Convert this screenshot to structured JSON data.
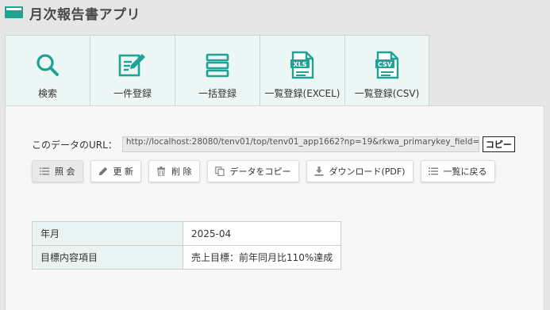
{
  "app": {
    "title": "月次報告書アプリ"
  },
  "tabs": [
    {
      "label": "検索",
      "icon": "search-icon"
    },
    {
      "label": "一件登録",
      "icon": "edit-form-icon"
    },
    {
      "label": "一括登録",
      "icon": "list-stack-icon"
    },
    {
      "label": "一覧登録(EXCEL)",
      "icon": "xls-file-icon",
      "badge": "XLS"
    },
    {
      "label": "一覧登録(CSV)",
      "icon": "csv-file-icon",
      "badge": "CSV"
    }
  ],
  "url_row": {
    "label": "このデータのURL：",
    "value": "http://localhost:28080/tenv01/top/tenv01_app1662?np=19&rkwa_primarykey_field=",
    "copy_label": "コピー"
  },
  "actions": [
    {
      "label": "照 会",
      "icon": "list-icon",
      "active": true
    },
    {
      "label": "更 新",
      "icon": "pencil-icon"
    },
    {
      "label": "削 除",
      "icon": "trash-icon"
    },
    {
      "label": "データをコピー",
      "icon": "copy-icon"
    },
    {
      "label": "ダウンロード(PDF)",
      "icon": "download-icon"
    },
    {
      "label": "一覧に戻る",
      "icon": "list-icon"
    }
  ],
  "record": [
    {
      "key": "年月",
      "value": "2025-04"
    },
    {
      "key": "目標内容項目",
      "value": "売上目標：前年同月比110%達成"
    }
  ],
  "colors": {
    "accent": "#1fa394",
    "tab_bg": "#ecf6f5",
    "key_bg": "#e8f3f2"
  }
}
